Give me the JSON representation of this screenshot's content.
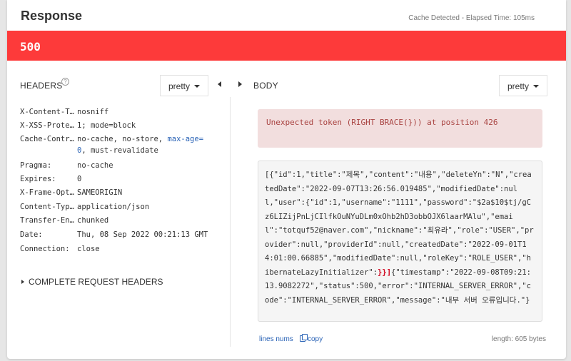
{
  "header": {
    "title": "Response",
    "cache_info": "Cache Detected - Elapsed Time: 105ms"
  },
  "status": {
    "code": "500",
    "color": "#fd3a3a"
  },
  "headers_panel": {
    "label": "HEADERS",
    "format": "pretty",
    "rows": [
      {
        "name": "X-Content-T…",
        "value": "nosniff"
      },
      {
        "name": "X-XSS-Prote…",
        "value": "1; mode=block"
      },
      {
        "name": "Cache-Contr…",
        "value_before": "no-cache, no-store, ",
        "value_keyword": "max-age=",
        "value_line2_keyword": "0",
        "value_line2_rest": ", must-revalidate"
      },
      {
        "name": "Pragma:",
        "value": "no-cache"
      },
      {
        "name": "Expires:",
        "value": "0"
      },
      {
        "name": "X-Frame-Opt…",
        "value": "SAMEORIGIN"
      },
      {
        "name": "Content-Typ…",
        "value": "application/json"
      },
      {
        "name": "Transfer-En…",
        "value": "chunked"
      },
      {
        "name": "Date:",
        "value": "Thu, 08 Sep 2022 00:21:13 GMT"
      },
      {
        "name": "Connection:",
        "value": "close"
      }
    ],
    "complete_label": "COMPLETE REQUEST HEADERS"
  },
  "body_panel": {
    "label": "BODY",
    "format": "pretty",
    "error_message": "Unexpected token (RIGHT BRACE(})) at position 426",
    "content_before": "[{\"id\":1,\"title\":\"제목\",\"content\":\"내용\",\"deleteYn\":\"N\",\"createdDate\":\"2022-09-07T13:26:56.019485\",\"modifiedDate\":null,\"user\":{\"id\":1,\"username\":\"1111\",\"password\":\"$2a$10$tj/gCz6LIZijPnLjCIlfkOuNYuDLm0xOhb2hD3obbOJX6laarMAlu\",\"email\":\"totquf52@naver.com\",\"nickname\":\"최유라\",\"role\":\"USER\",\"provider\":null,\"providerId\":null,\"createdDate\":\"2022-09-01T14:01:00.66885\",\"modifiedDate\":null,\"roleKey\":\"ROLE_USER\",\"hibernateLazyInitializer\":",
    "content_error": "}}]",
    "content_after": "{\"timestamp\":\"2022-09-08T09:21:13.9082272\",\"status\":500,\"error\":\"INTERNAL_SERVER_ERROR\",\"code\":\"INTERNAL_SERVER_ERROR\",\"message\":\"내부 서버 오류입니다.\"}",
    "lines_nums_label": "lines nums",
    "copy_label": "copy",
    "length_info": "length: 605 bytes"
  }
}
